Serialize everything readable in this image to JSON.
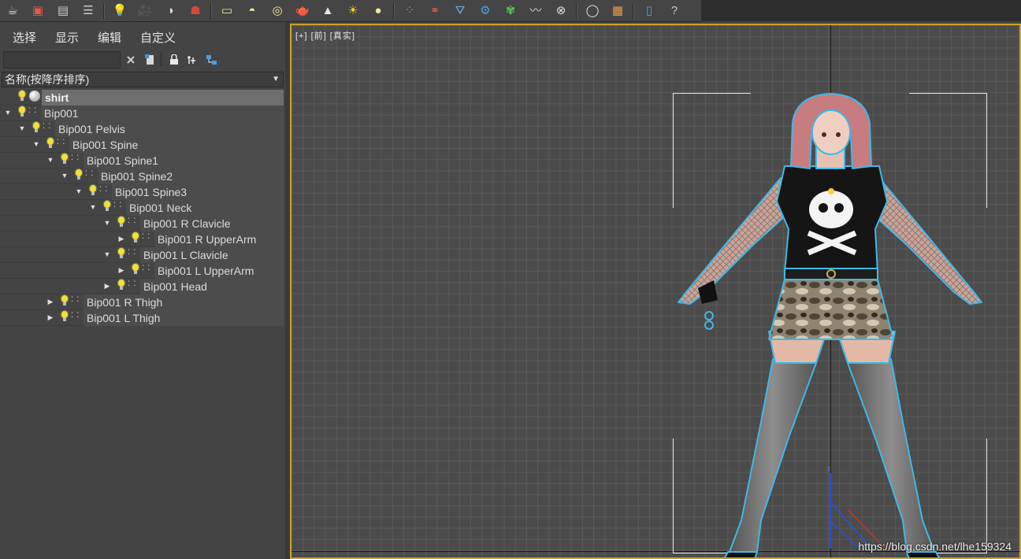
{
  "toolbar": {
    "icons": [
      "teapot-render-icon",
      "render-frame-icon",
      "render-setup-icon",
      "material-list-icon",
      "light-list-icon",
      "camera-icon",
      "shading-icon",
      "render-robot-icon",
      "plane-icon",
      "hemisphere-icon",
      "sphere-ring-icon",
      "teapot-icon",
      "cone-icon",
      "sun-light-icon",
      "sphere-light-icon",
      "particles-icon",
      "molecule-icon",
      "cloth-icon",
      "gear-icon",
      "grass-icon",
      "hair-fur-icon",
      "ox-texture-icon",
      "sphere-icon",
      "layers-icon",
      "document-icon",
      "help-icon"
    ]
  },
  "panel": {
    "menu": [
      "选择",
      "显示",
      "编辑",
      "自定义"
    ],
    "search": {
      "value": ""
    },
    "sort_label": "名称(按降序排序)",
    "tree": [
      {
        "label": "shirt",
        "depth": 0,
        "toggle": "",
        "type": "mesh",
        "selected": true
      },
      {
        "label": "Bip001",
        "depth": 0,
        "toggle": "▼",
        "type": "bone"
      },
      {
        "label": "Bip001 Pelvis",
        "depth": 1,
        "toggle": "▼",
        "type": "bone"
      },
      {
        "label": "Bip001 Spine",
        "depth": 2,
        "toggle": "▼",
        "type": "bone"
      },
      {
        "label": "Bip001 Spine1",
        "depth": 3,
        "toggle": "▼",
        "type": "bone"
      },
      {
        "label": "Bip001 Spine2",
        "depth": 4,
        "toggle": "▼",
        "type": "bone"
      },
      {
        "label": "Bip001 Spine3",
        "depth": 5,
        "toggle": "▼",
        "type": "bone"
      },
      {
        "label": "Bip001 Neck",
        "depth": 6,
        "toggle": "▼",
        "type": "bone"
      },
      {
        "label": "Bip001 R Clavicle",
        "depth": 7,
        "toggle": "▼",
        "type": "bone"
      },
      {
        "label": "Bip001 R UpperArm",
        "depth": 8,
        "toggle": "▶",
        "type": "bone"
      },
      {
        "label": "Bip001 L Clavicle",
        "depth": 7,
        "toggle": "▼",
        "type": "bone"
      },
      {
        "label": "Bip001 L UpperArm",
        "depth": 8,
        "toggle": "▶",
        "type": "bone"
      },
      {
        "label": "Bip001 Head",
        "depth": 7,
        "toggle": "▶",
        "type": "bone"
      },
      {
        "label": "Bip001 R Thigh",
        "depth": 3,
        "toggle": "▶",
        "type": "bone"
      },
      {
        "label": "Bip001 L Thigh",
        "depth": 3,
        "toggle": "▶",
        "type": "bone"
      }
    ]
  },
  "viewport": {
    "label": "[+] [前] [真实]",
    "watermark": "https://blog.csdn.net/lhe159324",
    "axis_label": "z",
    "selection_color": "#3fb8e8",
    "border_color": "#c9a228"
  }
}
